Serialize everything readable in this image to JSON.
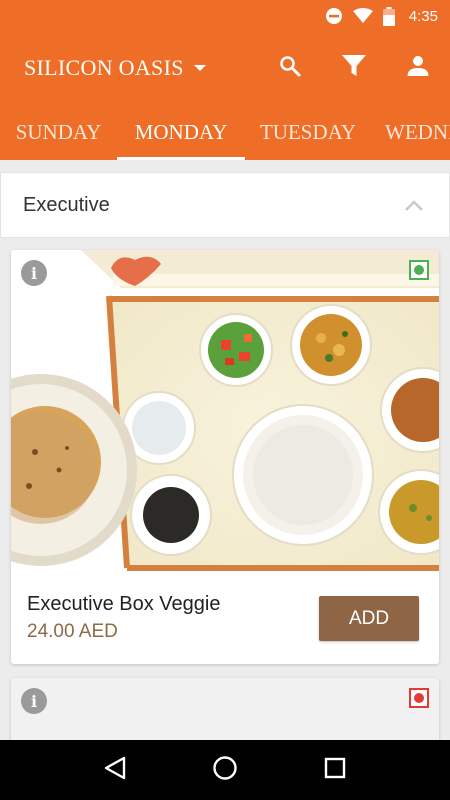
{
  "status_bar": {
    "time": "4:35",
    "icons": [
      "do-not-disturb-icon",
      "wifi-icon",
      "battery-icon"
    ]
  },
  "toolbar": {
    "location": "SILICON OASIS",
    "actions": [
      "search-icon",
      "filter-icon",
      "account-icon"
    ]
  },
  "tabs": [
    {
      "label": "SUNDAY",
      "active": false
    },
    {
      "label": "MONDAY",
      "active": true
    },
    {
      "label": "TUESDAY",
      "active": false
    },
    {
      "label": "WEDNESDAY",
      "active": false
    }
  ],
  "section": {
    "title": "Executive",
    "expanded": true
  },
  "items": [
    {
      "name": "Executive Box Veggie",
      "price": "24.00 AED",
      "button": "ADD",
      "diet": "veg"
    },
    {
      "diet": "non-veg"
    }
  ],
  "colors": {
    "primary": "#ee6d27",
    "button": "#8f6645",
    "price": "#8d6a46",
    "veg": "#4caf50",
    "non_veg": "#e53935"
  },
  "nav_bar": [
    "back-icon",
    "home-icon",
    "recents-icon"
  ]
}
